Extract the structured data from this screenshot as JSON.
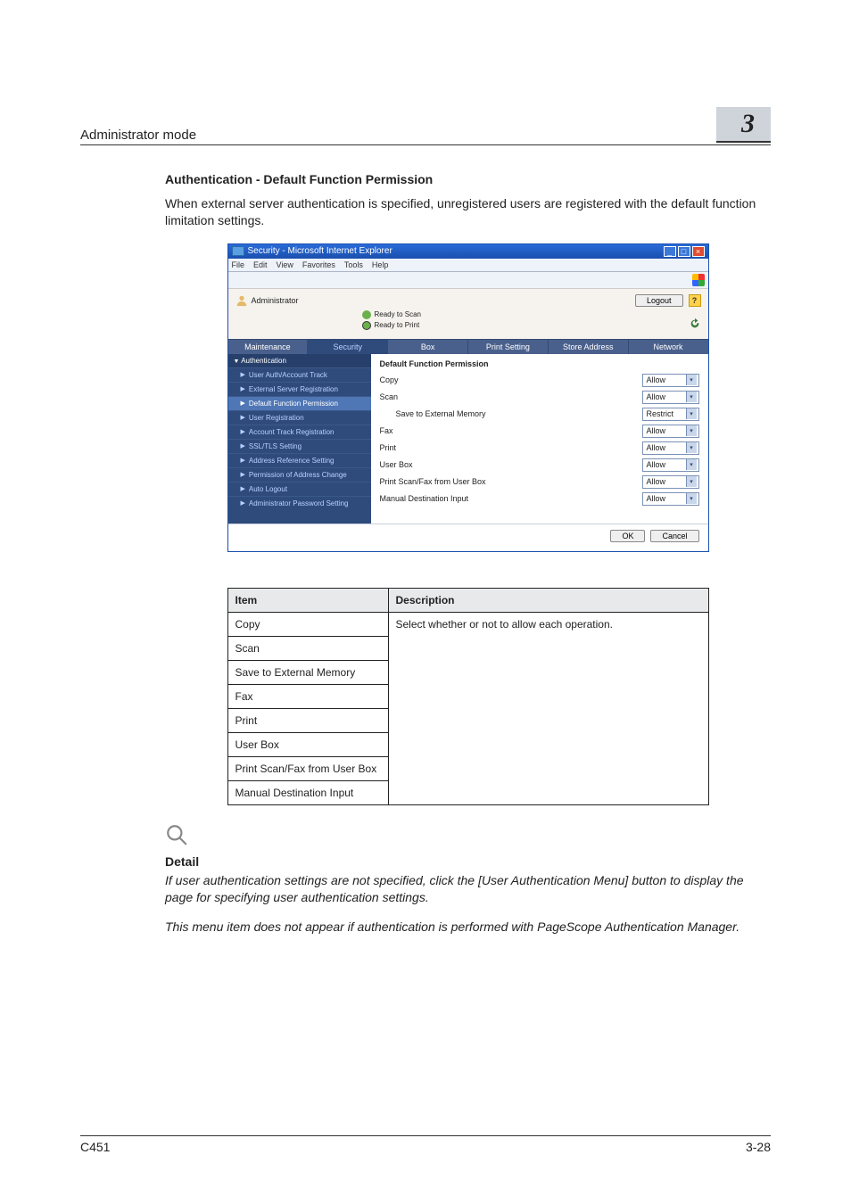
{
  "header": {
    "title": "Administrator mode",
    "chapter": "3"
  },
  "section": {
    "heading": "Authentication - Default Function Permission",
    "intro": "When external server authentication is specified, unregistered users are registered with the default function limitation settings."
  },
  "browser": {
    "title": "Security - Microsoft Internet Explorer",
    "menus": [
      "File",
      "Edit",
      "View",
      "Favorites",
      "Tools",
      "Help"
    ],
    "admin_label": "Administrator",
    "logout_label": "Logout",
    "status": {
      "scan": "Ready to Scan",
      "print": "Ready to Print"
    },
    "tabs": [
      "Maintenance",
      "Security",
      "Box",
      "Print Setting",
      "Store Address",
      "Network"
    ],
    "active_tab": "Security",
    "sidebar": {
      "header": "Authentication",
      "items": [
        "User Auth/Account Track",
        "External Server Registration",
        "Default Function Permission",
        "User Registration",
        "Account Track Registration",
        "SSL/TLS Setting",
        "Address Reference Setting",
        "Permission of Address Change",
        "Auto Logout",
        "Administrator Password Setting"
      ],
      "selected_index": 2
    },
    "panel": {
      "title": "Default Function Permission",
      "rows": [
        {
          "label": "Copy",
          "value": "Allow",
          "indent": false
        },
        {
          "label": "Scan",
          "value": "Allow",
          "indent": false
        },
        {
          "label": "Save to External Memory",
          "value": "Restrict",
          "indent": true
        },
        {
          "label": "Fax",
          "value": "Allow",
          "indent": false
        },
        {
          "label": "Print",
          "value": "Allow",
          "indent": false
        },
        {
          "label": "User Box",
          "value": "Allow",
          "indent": false
        },
        {
          "label": "Print Scan/Fax from User Box",
          "value": "Allow",
          "indent": false
        },
        {
          "label": "Manual Destination Input",
          "value": "Allow",
          "indent": false
        }
      ],
      "ok": "OK",
      "cancel": "Cancel"
    }
  },
  "table": {
    "head_item": "Item",
    "head_desc": "Description",
    "desc": "Select whether or not to allow each operation.",
    "items": [
      "Copy",
      "Scan",
      "Save to External Memory",
      "Fax",
      "Print",
      "User Box",
      "Print Scan/Fax from User Box",
      "Manual Destination Input"
    ]
  },
  "note": {
    "head": "Detail",
    "p1": "If user authentication settings are not specified, click the [User Authentication Menu] button to display the page for specifying user authentication settings.",
    "p2": "This menu item does not appear if authentication is performed with PageScope Authentication Manager."
  },
  "footer": {
    "left": "C451",
    "right": "3-28"
  }
}
